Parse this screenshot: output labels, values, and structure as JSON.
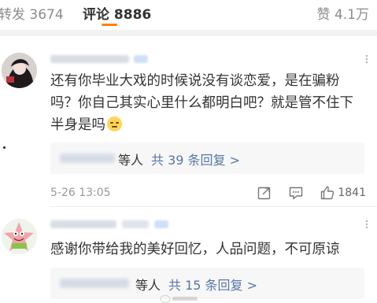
{
  "tabs": {
    "repost": "转发 3674",
    "comment": "评论 8886",
    "like": "赞 4.1万"
  },
  "comments": [
    {
      "text": "还有你毕业大戏的时候说没有谈恋爱，是在骗粉吗？你自己其实心里什么都明白吧？就是管不住下半身是吗",
      "emoji": "sleepy-face-emoji",
      "replies": {
        "etc": "等人",
        "link": "共 39 条回复 >"
      },
      "time": "5-26 13:05",
      "likes": "1841"
    },
    {
      "text": "感谢你带给我的美好回忆，人品问题，不可原谅",
      "replies": {
        "etc": "等人",
        "link": "共 15 条回复 >"
      }
    }
  ],
  "colors": {
    "accent": "#ff8200",
    "link": "#5677a8",
    "text": "#333333",
    "muted": "#999999"
  }
}
